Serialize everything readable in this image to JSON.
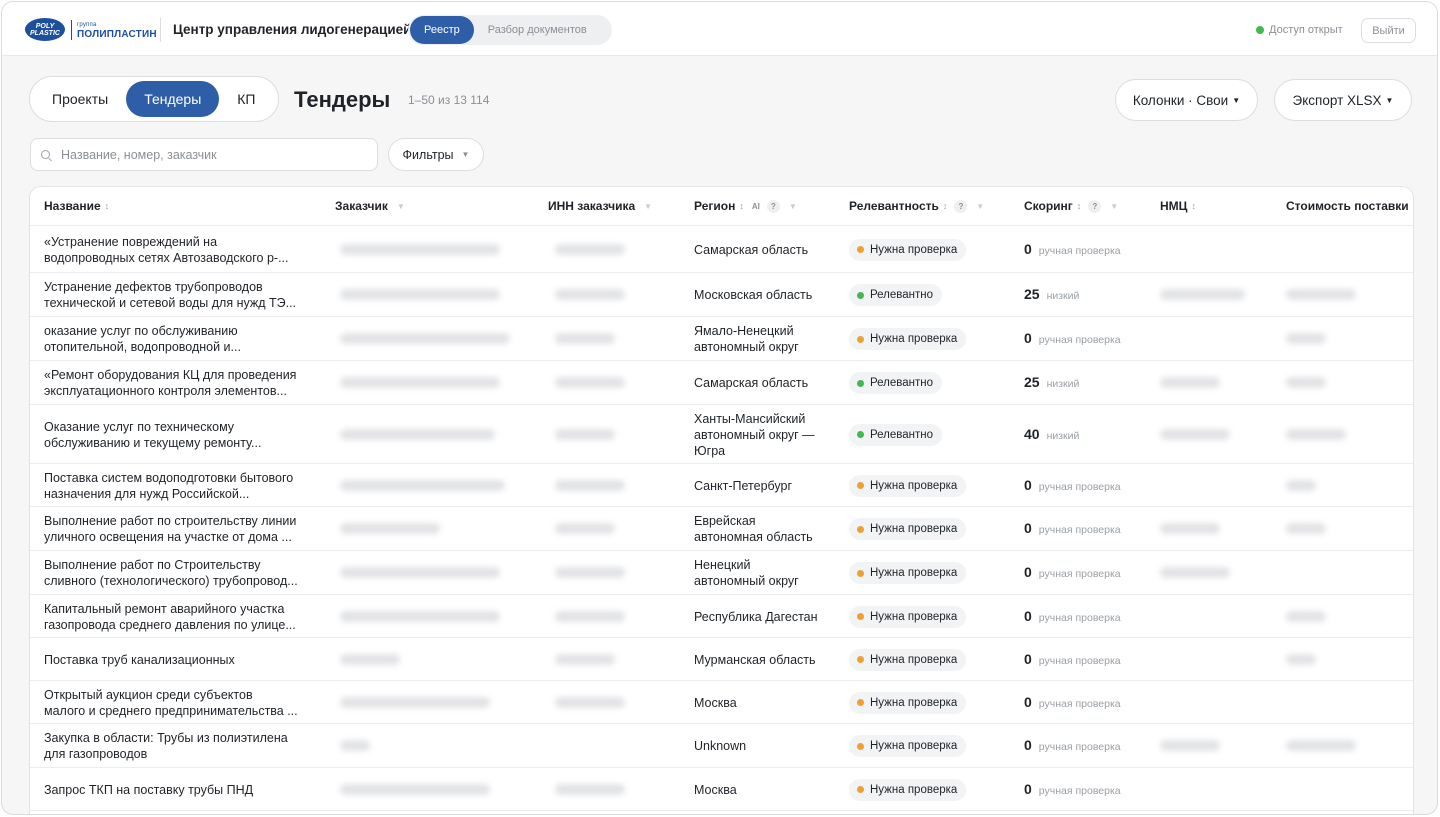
{
  "header": {
    "logo_small": "группа",
    "logo_big": "ПОЛИПЛАСТИН",
    "logo_mark": "POLY PLASTIC",
    "app_title": "Центр управления лидогенерацией",
    "nav": [
      "Реестр",
      "Разбор документов"
    ],
    "access_status": "Доступ открыт",
    "logout_label": "Выйти"
  },
  "toolbar": {
    "tabs": [
      "Проекты",
      "Тендеры",
      "КП"
    ],
    "title": "Тендеры",
    "count": "1–50 из 13 114",
    "columns_label": "Колонки · Свои",
    "export_label": "Экспорт XLSX",
    "search_placeholder": "Название, номер, заказчик",
    "filters_label": "Фильтры"
  },
  "table": {
    "columns": [
      "Название",
      "Заказчик",
      "ИНН заказчика",
      "Регион",
      "Релевантность",
      "Скоринг",
      "НМЦ",
      "Стоимость поставки"
    ],
    "ai_tag": "AI",
    "help_mark": "?",
    "rows": [
      {
        "name": [
          "«Устранение повреждений на",
          "водопроводных сетях Автозаводского р-..."
        ],
        "region": [
          "Самарская область"
        ],
        "relevance": "Нужна проверка",
        "status": "warn",
        "score": "0",
        "score_label": "ручная проверка"
      },
      {
        "name": [
          "Устранение дефектов трубопроводов",
          "технической и сетевой воды для нужд ТЭ..."
        ],
        "region": [
          "Московская область"
        ],
        "relevance": "Релевантно",
        "status": "ok",
        "score": "25",
        "score_label": "низкий"
      },
      {
        "name": [
          "оказание услуг по обслуживанию",
          "отопительной, водопроводной и..."
        ],
        "region": [
          "Ямало-Ненецкий",
          "автономный округ"
        ],
        "relevance": "Нужна проверка",
        "status": "warn",
        "score": "0",
        "score_label": "ручная проверка"
      },
      {
        "name": [
          "«Ремонт оборудования КЦ для проведения",
          "эксплуатационного контроля элементов..."
        ],
        "region": [
          "Самарская область"
        ],
        "relevance": "Релевантно",
        "status": "ok",
        "score": "25",
        "score_label": "низкий"
      },
      {
        "name": [
          "Оказание услуг по техническому",
          "обслуживанию и текущему ремонту..."
        ],
        "region": [
          "Ханты-Мансийский",
          "автономный округ —",
          "Югра"
        ],
        "relevance": "Релевантно",
        "status": "ok",
        "score": "40",
        "score_label": "низкий"
      },
      {
        "name": [
          "Поставка систем водоподготовки бытового",
          "назначения для нужд Российской..."
        ],
        "region": [
          "Санкт-Петербург"
        ],
        "relevance": "Нужна проверка",
        "status": "warn",
        "score": "0",
        "score_label": "ручная проверка"
      },
      {
        "name": [
          "Выполнение работ по строительству линии",
          "уличного освещения на участке от дома ..."
        ],
        "region": [
          "Еврейская",
          "автономная область"
        ],
        "relevance": "Нужна проверка",
        "status": "warn",
        "score": "0",
        "score_label": "ручная проверка"
      },
      {
        "name": [
          "Выполнение работ по Строительству",
          "сливного (технологического) трубопровод..."
        ],
        "region": [
          "Ненецкий",
          "автономный округ"
        ],
        "relevance": "Нужна проверка",
        "status": "warn",
        "score": "0",
        "score_label": "ручная проверка"
      },
      {
        "name": [
          "Капитальный ремонт аварийного участка",
          "газопровода среднего давления по улице..."
        ],
        "region": [
          "Республика Дагестан"
        ],
        "relevance": "Нужна проверка",
        "status": "warn",
        "score": "0",
        "score_label": "ручная проверка"
      },
      {
        "name": [
          "Поставка труб канализационных"
        ],
        "region": [
          "Мурманская область"
        ],
        "relevance": "Нужна проверка",
        "status": "warn",
        "score": "0",
        "score_label": "ручная проверка"
      },
      {
        "name": [
          "Открытый аукцион среди субъектов",
          "малого и среднего предпринимательства ..."
        ],
        "region": [
          "Москва"
        ],
        "relevance": "Нужна проверка",
        "status": "warn",
        "score": "0",
        "score_label": "ручная проверка"
      },
      {
        "name": [
          "Закупка в области: Трубы из полиэтилена",
          "для газопроводов"
        ],
        "region": [
          "Unknown"
        ],
        "relevance": "Нужна проверка",
        "status": "warn",
        "score": "0",
        "score_label": "ручная проверка"
      },
      {
        "name": [
          "Запрос ТКП на поставку трубы ПНД"
        ],
        "region": [
          "Москва"
        ],
        "relevance": "Нужна проверка",
        "status": "warn",
        "score": "0",
        "score_label": "ручная проверка"
      }
    ]
  },
  "colors": {
    "accent": "#2f5ea8",
    "ok": "#3fb950",
    "warn": "#f0a030"
  }
}
